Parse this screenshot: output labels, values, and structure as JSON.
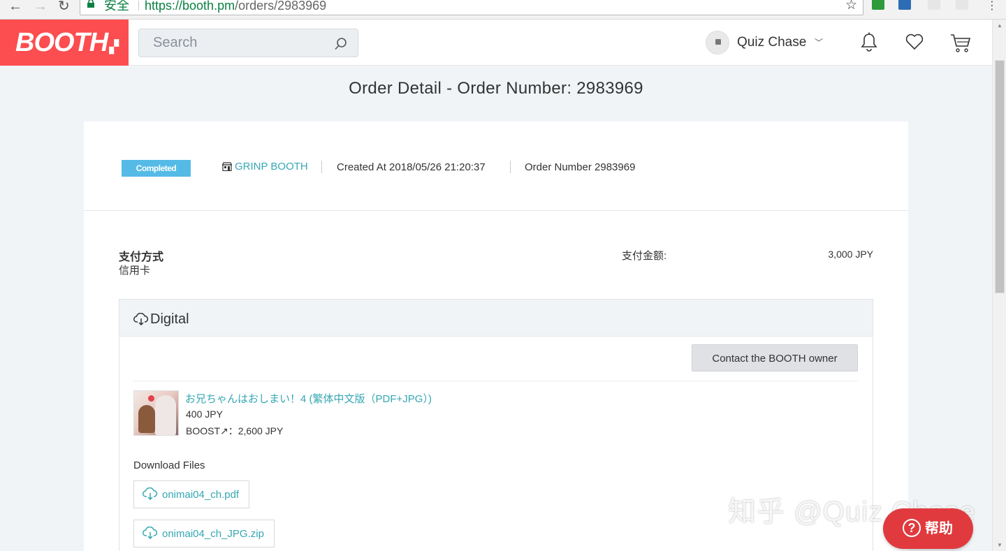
{
  "browser": {
    "secure_label": "安全",
    "url_host": "https://booth.pm",
    "url_path": "/orders/2983969"
  },
  "header": {
    "logo": "BOOTH",
    "search_placeholder": "Search",
    "username": "Quiz Chase",
    "icons": [
      "bell-icon",
      "heart-icon",
      "cart-icon"
    ]
  },
  "page": {
    "title": "Order Detail - Order Number: 2983969"
  },
  "order": {
    "status": "Completed",
    "shop": "GRINP BOOTH",
    "created_at": "Created At 2018/05/26 21:20:37",
    "order_number": "Order Number 2983969",
    "payment_label": "支付方式",
    "payment_method": "信用卡",
    "amount_label": "支付金额:",
    "amount": "3,000 JPY"
  },
  "digital": {
    "heading": "Digital",
    "contact_button": "Contact the BOOTH owner",
    "product": {
      "name": "お兄ちゃんはおしまい！4 (繁体中文版（PDF+JPG）)",
      "price": "400 JPY",
      "boost": "BOOST↗：2,600 JPY"
    },
    "downloads_title": "Download Files",
    "files": [
      "onimai04_ch.pdf",
      "onimai04_ch_JPG.zip"
    ]
  },
  "overlay": {
    "watermark": "知乎 @Quiz Chase",
    "help": "帮助"
  },
  "colors": {
    "brand": "#fc4d50",
    "link": "#35a7b3",
    "badge": "#55bbe6",
    "help": "#e03a3e"
  }
}
